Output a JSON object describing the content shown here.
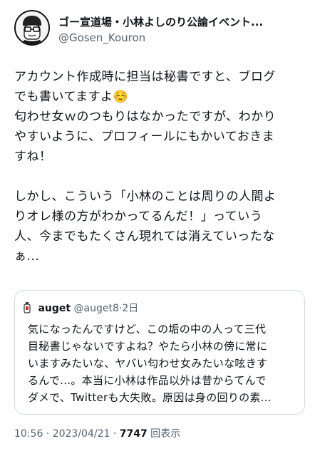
{
  "author": {
    "name": "ゴー宣道場・小林よしのり公論イベント...",
    "handle": "@Gosen_Kouron"
  },
  "tweet": {
    "paragraph1": "アカウント作成時に担当は秘書ですと、ブログ\nでも書いてますよ☺️\n匂わせ女ｗのつもりはなかったですが、わかり\nやすいように、プロフィールにもかいておきま\nすね！",
    "paragraph2": "しかし、こういう「小林のことは周りの人間よ\nりオレ様の方がわかってるんだ！」っていう\n人、今までもたくさん現れては消えていったな\nぁ..."
  },
  "quote": {
    "name": "auget",
    "handle": "@auget8",
    "time": "·2日",
    "text": "気になったんですけど、この垢の中の人って三代\n目秘書じゃないですよね？やたら小林の傍に常に\nいますみたいな、ヤバい匂わせ女みたいな呟きす\nるんで...。本当に小林は作品以外は昔からてんで\nダメで、Twitterも大失敗。原因は身の回りの素..."
  },
  "footer": {
    "timestamp": "10:56 · 2023/04/21 · ",
    "views": "7747",
    "views_label": " 回表示"
  }
}
